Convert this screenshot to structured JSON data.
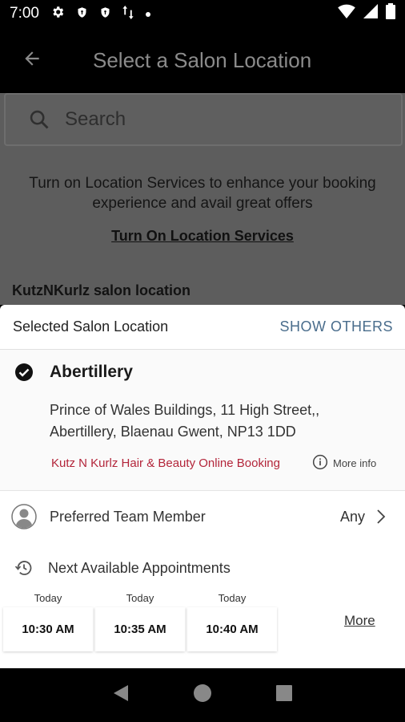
{
  "status_bar": {
    "time": "7:00",
    "icons_left": [
      "gear-icon",
      "shield-icon",
      "shield-icon",
      "data-arrows-icon",
      "dot-icon"
    ],
    "icons_right": [
      "wifi-icon",
      "signal-icon",
      "battery-icon"
    ]
  },
  "app_bar": {
    "title": "Select a Salon Location",
    "back_icon": "arrow-back-icon"
  },
  "search": {
    "placeholder": "Search"
  },
  "location_services": {
    "message": "Turn on Location Services to enhance your booking experience and avail great offers",
    "link": "Turn On Location Services"
  },
  "salon_section_heading": "KutzNKurlz salon location",
  "sheet": {
    "header_label": "Selected Salon Location",
    "show_others": "SHOW OTHERS",
    "salon": {
      "name": "Abertillery",
      "address": "Prince of Wales Buildings, 11 High Street,, Abertillery, Blaenau Gwent, NP13 1DD",
      "online_link": "Kutz N Kurlz Hair & Beauty Online Booking",
      "more_info": "More info"
    },
    "team": {
      "label": "Preferred Team Member",
      "value": "Any"
    },
    "next": {
      "label": "Next Available Appointments",
      "slots": [
        {
          "day": "Today",
          "time": "10:30 AM"
        },
        {
          "day": "Today",
          "time": "10:35 AM"
        },
        {
          "day": "Today",
          "time": "10:40 AM"
        }
      ],
      "more": "More"
    }
  },
  "colors": {
    "accent": "#4a6d8c",
    "link_red": "#b3253a",
    "overlay_bg": "#5d5d5d"
  }
}
